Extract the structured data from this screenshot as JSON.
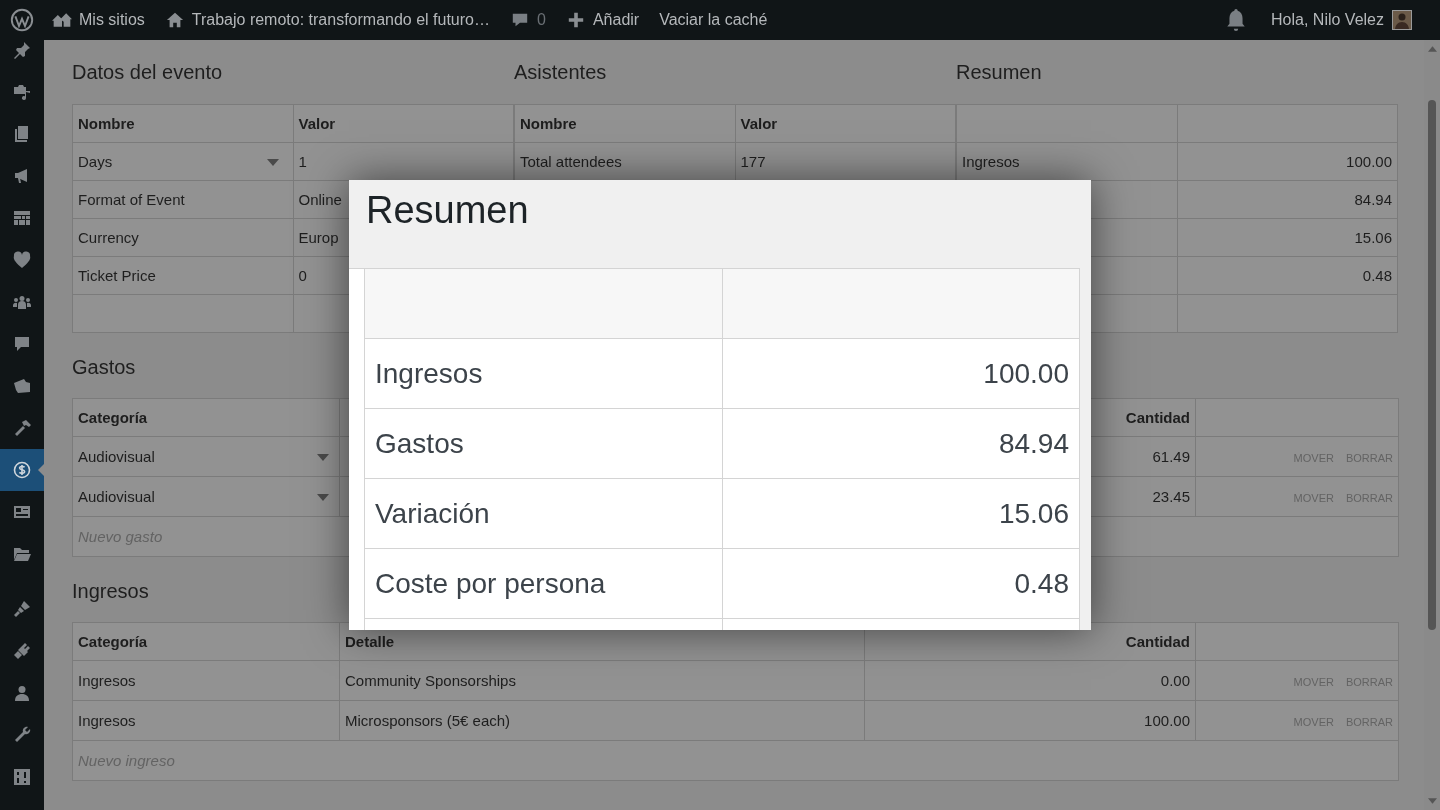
{
  "admin_bar": {
    "my_sites": "Mis sitios",
    "site_name": "Trabajo remoto: transformando el futuro…",
    "comments": "0",
    "new": "Añadir",
    "clear_cache": "Vaciar la caché",
    "greeting": "Hola, Nilo Velez"
  },
  "sidebar": {
    "items": [
      {
        "selected": false
      },
      {
        "selected": false
      },
      {
        "selected": false
      },
      {
        "selected": false
      },
      {
        "selected": false
      },
      {
        "selected": false
      },
      {
        "selected": false
      },
      {
        "selected": false
      },
      {
        "selected": false
      },
      {
        "selected": false
      },
      {
        "selected": true
      },
      {
        "selected": false
      },
      {
        "selected": false
      },
      {
        "selected": false
      },
      {
        "selected": false
      },
      {
        "selected": false
      },
      {
        "selected": false
      },
      {
        "selected": false
      }
    ]
  },
  "top_sections": [
    {
      "title": "Datos del evento",
      "columns": [
        {
          "label": "Nombre",
          "kind": "text"
        },
        {
          "label": "Valor",
          "kind": "text"
        }
      ],
      "rows": [
        {
          "kind": "row",
          "cells": [
            "Days",
            "1"
          ],
          "dropdown": true
        },
        {
          "kind": "row",
          "cells": [
            "Format of Event",
            "Online"
          ],
          "dropdown": false
        },
        {
          "kind": "row",
          "cells": [
            "Currency",
            "Europ"
          ],
          "dropdown": false
        },
        {
          "kind": "row",
          "cells": [
            "Ticket Price",
            "0"
          ],
          "dropdown": false
        },
        {
          "kind": "blank"
        }
      ]
    },
    {
      "title": "Asistentes",
      "columns": [
        {
          "label": "Nombre",
          "kind": "text"
        },
        {
          "label": "Valor",
          "kind": "text"
        }
      ],
      "rows": [
        {
          "kind": "row",
          "cells": [
            "Total attendees",
            "177"
          ],
          "dropdown": false
        }
      ]
    },
    {
      "title": "Resumen",
      "columns": [
        {
          "kind": "text"
        },
        {
          "kind": "number"
        }
      ],
      "rows": [
        {
          "kind": "row",
          "cells": [
            "Ingresos",
            "100.00"
          ]
        },
        {
          "kind": "row",
          "cells": [
            null,
            "84.94"
          ]
        },
        {
          "kind": "row",
          "cells": [
            null,
            "15.06"
          ]
        },
        {
          "kind": "row",
          "cells": [
            null,
            "0.48"
          ]
        },
        {
          "kind": "blank"
        }
      ]
    }
  ],
  "sections": [
    {
      "title": "Gastos",
      "columns": [
        {
          "label": "Categoría",
          "kind": "text"
        },
        {
          "kind": "text"
        },
        {
          "label": "Cantidad",
          "kind": "number"
        },
        {
          "kind": "actions"
        }
      ],
      "rows": [
        {
          "cells": [
            "Audiovisual",
            null,
            "61.49"
          ],
          "dropdown": true,
          "actions": [
            "MOVER",
            "BORRAR"
          ]
        },
        {
          "cells": [
            "Audiovisual",
            null,
            "23.45"
          ],
          "dropdown": true,
          "actions": [
            "MOVER",
            "BORRAR"
          ]
        }
      ],
      "new_row": "Nuevo gasto"
    },
    {
      "title": "Ingresos",
      "columns": [
        {
          "label": "Categoría",
          "kind": "text"
        },
        {
          "label": "Detalle",
          "kind": "text"
        },
        {
          "label": "Cantidad",
          "kind": "number"
        },
        {
          "kind": "actions"
        }
      ],
      "rows": [
        {
          "cells": [
            "Ingresos",
            "Community Sponsorships",
            "0.00"
          ],
          "dropdown": false,
          "actions": [
            "MOVER",
            "BORRAR"
          ]
        },
        {
          "cells": [
            "Ingresos",
            "Microsponsors (5€ each)",
            "100.00"
          ],
          "dropdown": false,
          "actions": [
            "MOVER",
            "BORRAR"
          ]
        }
      ],
      "new_row": "Nuevo ingreso"
    }
  ],
  "modal": {
    "title": "Resumen",
    "rows": [
      {
        "label": "Ingresos",
        "value": "100.00"
      },
      {
        "label": "Gastos",
        "value": "84.94"
      },
      {
        "label": "Variación",
        "value": "15.06"
      },
      {
        "label": "Coste por persona",
        "value": "0.48"
      }
    ]
  }
}
